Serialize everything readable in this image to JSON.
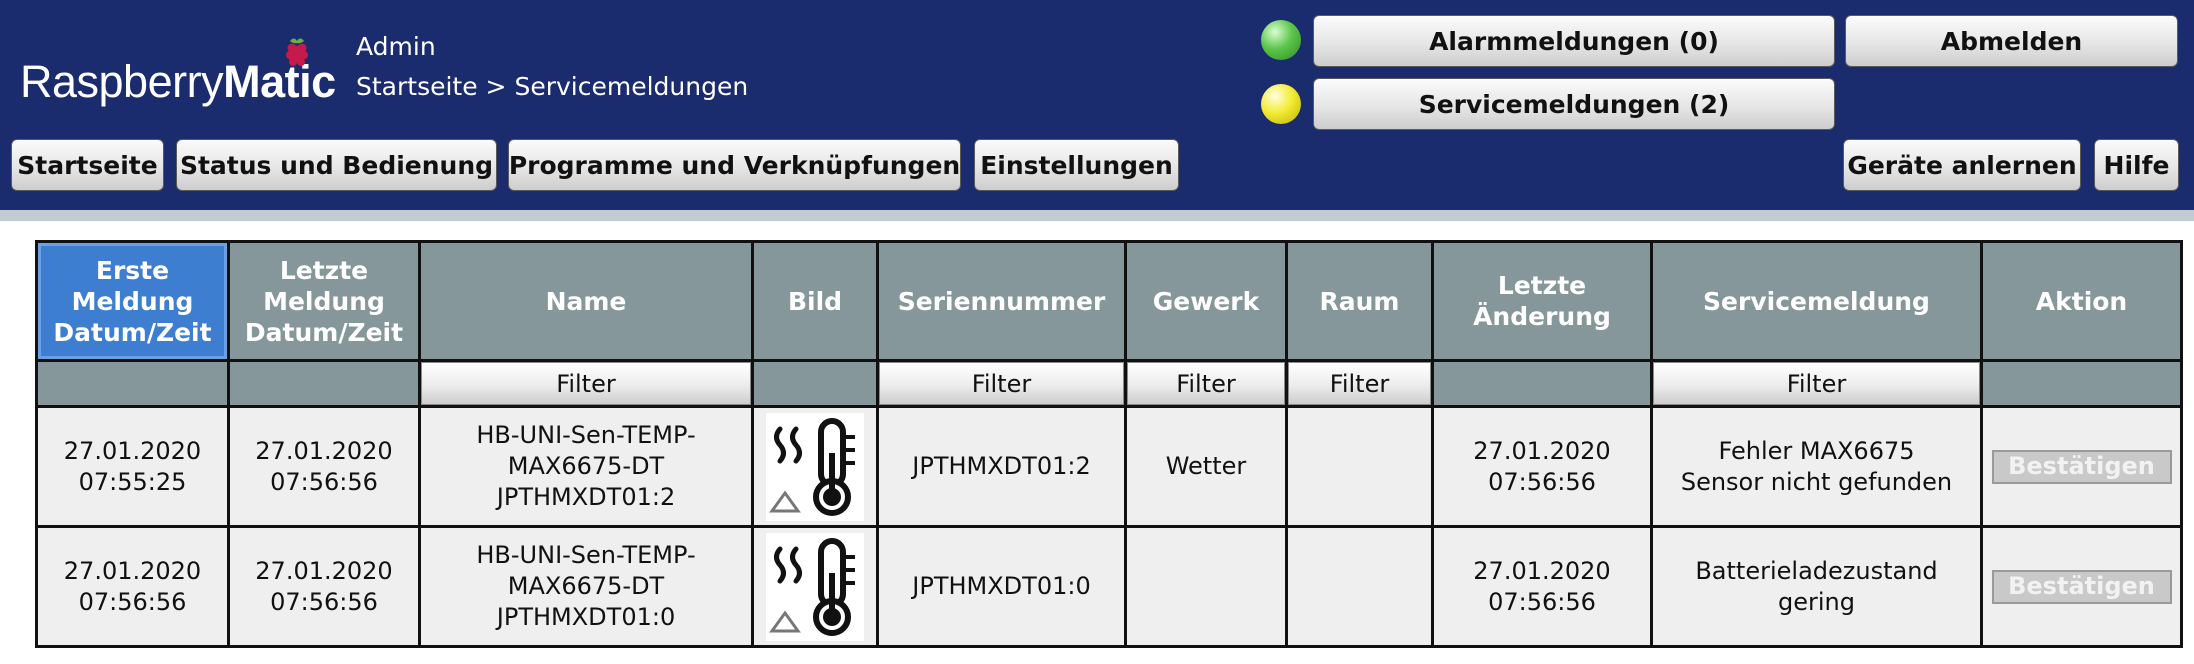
{
  "header": {
    "logo": {
      "part1": "Raspberry",
      "part2": "Matic"
    },
    "user": "Admin",
    "breadcrumb": "Startseite > Servicemeldungen",
    "status_colors": {
      "alarm_led": "#5cc54a",
      "service_led": "#f3ec35",
      "header_bg": "#1a2b6e"
    },
    "alarm_button": "Alarmmeldungen (0)",
    "service_button": "Servicemeldungen (2)",
    "logout_button": "Abmelden"
  },
  "nav": {
    "items": [
      "Startseite",
      "Status und Bedienung",
      "Programme und Verknüpfungen",
      "Einstellungen"
    ],
    "right_items": [
      "Geräte anlernen",
      "Hilfe"
    ]
  },
  "table": {
    "columns": [
      "Erste\nMeldung\nDatum/Zeit",
      "Letzte\nMeldung\nDatum/Zeit",
      "Name",
      "Bild",
      "Seriennummer",
      "Gewerk",
      "Raum",
      "Letzte\nÄnderung",
      "Servicemeldung",
      "Aktion"
    ],
    "filter_label": "Filter",
    "rows": [
      {
        "first": "27.01.2020\n07:55:25",
        "last": "27.01.2020\n07:56:56",
        "name": "HB-UNI-Sen-TEMP-\nMAX6675-DT\nJPTHMXDT01:2",
        "image_icon": "temperature-sensor-icon",
        "serial": "JPTHMXDT01:2",
        "trade": "Wetter",
        "room": "",
        "changed": "27.01.2020\n07:56:56",
        "message": "Fehler MAX6675\nSensor nicht gefunden",
        "action": "Bestätigen"
      },
      {
        "first": "27.01.2020\n07:56:56",
        "last": "27.01.2020\n07:56:56",
        "name": "HB-UNI-Sen-TEMP-\nMAX6675-DT\nJPTHMXDT01:0",
        "image_icon": "temperature-sensor-icon",
        "serial": "JPTHMXDT01:0",
        "trade": "",
        "room": "",
        "changed": "27.01.2020\n07:56:56",
        "message": "Batterieladezustand\ngering",
        "action": "Bestätigen"
      }
    ]
  }
}
